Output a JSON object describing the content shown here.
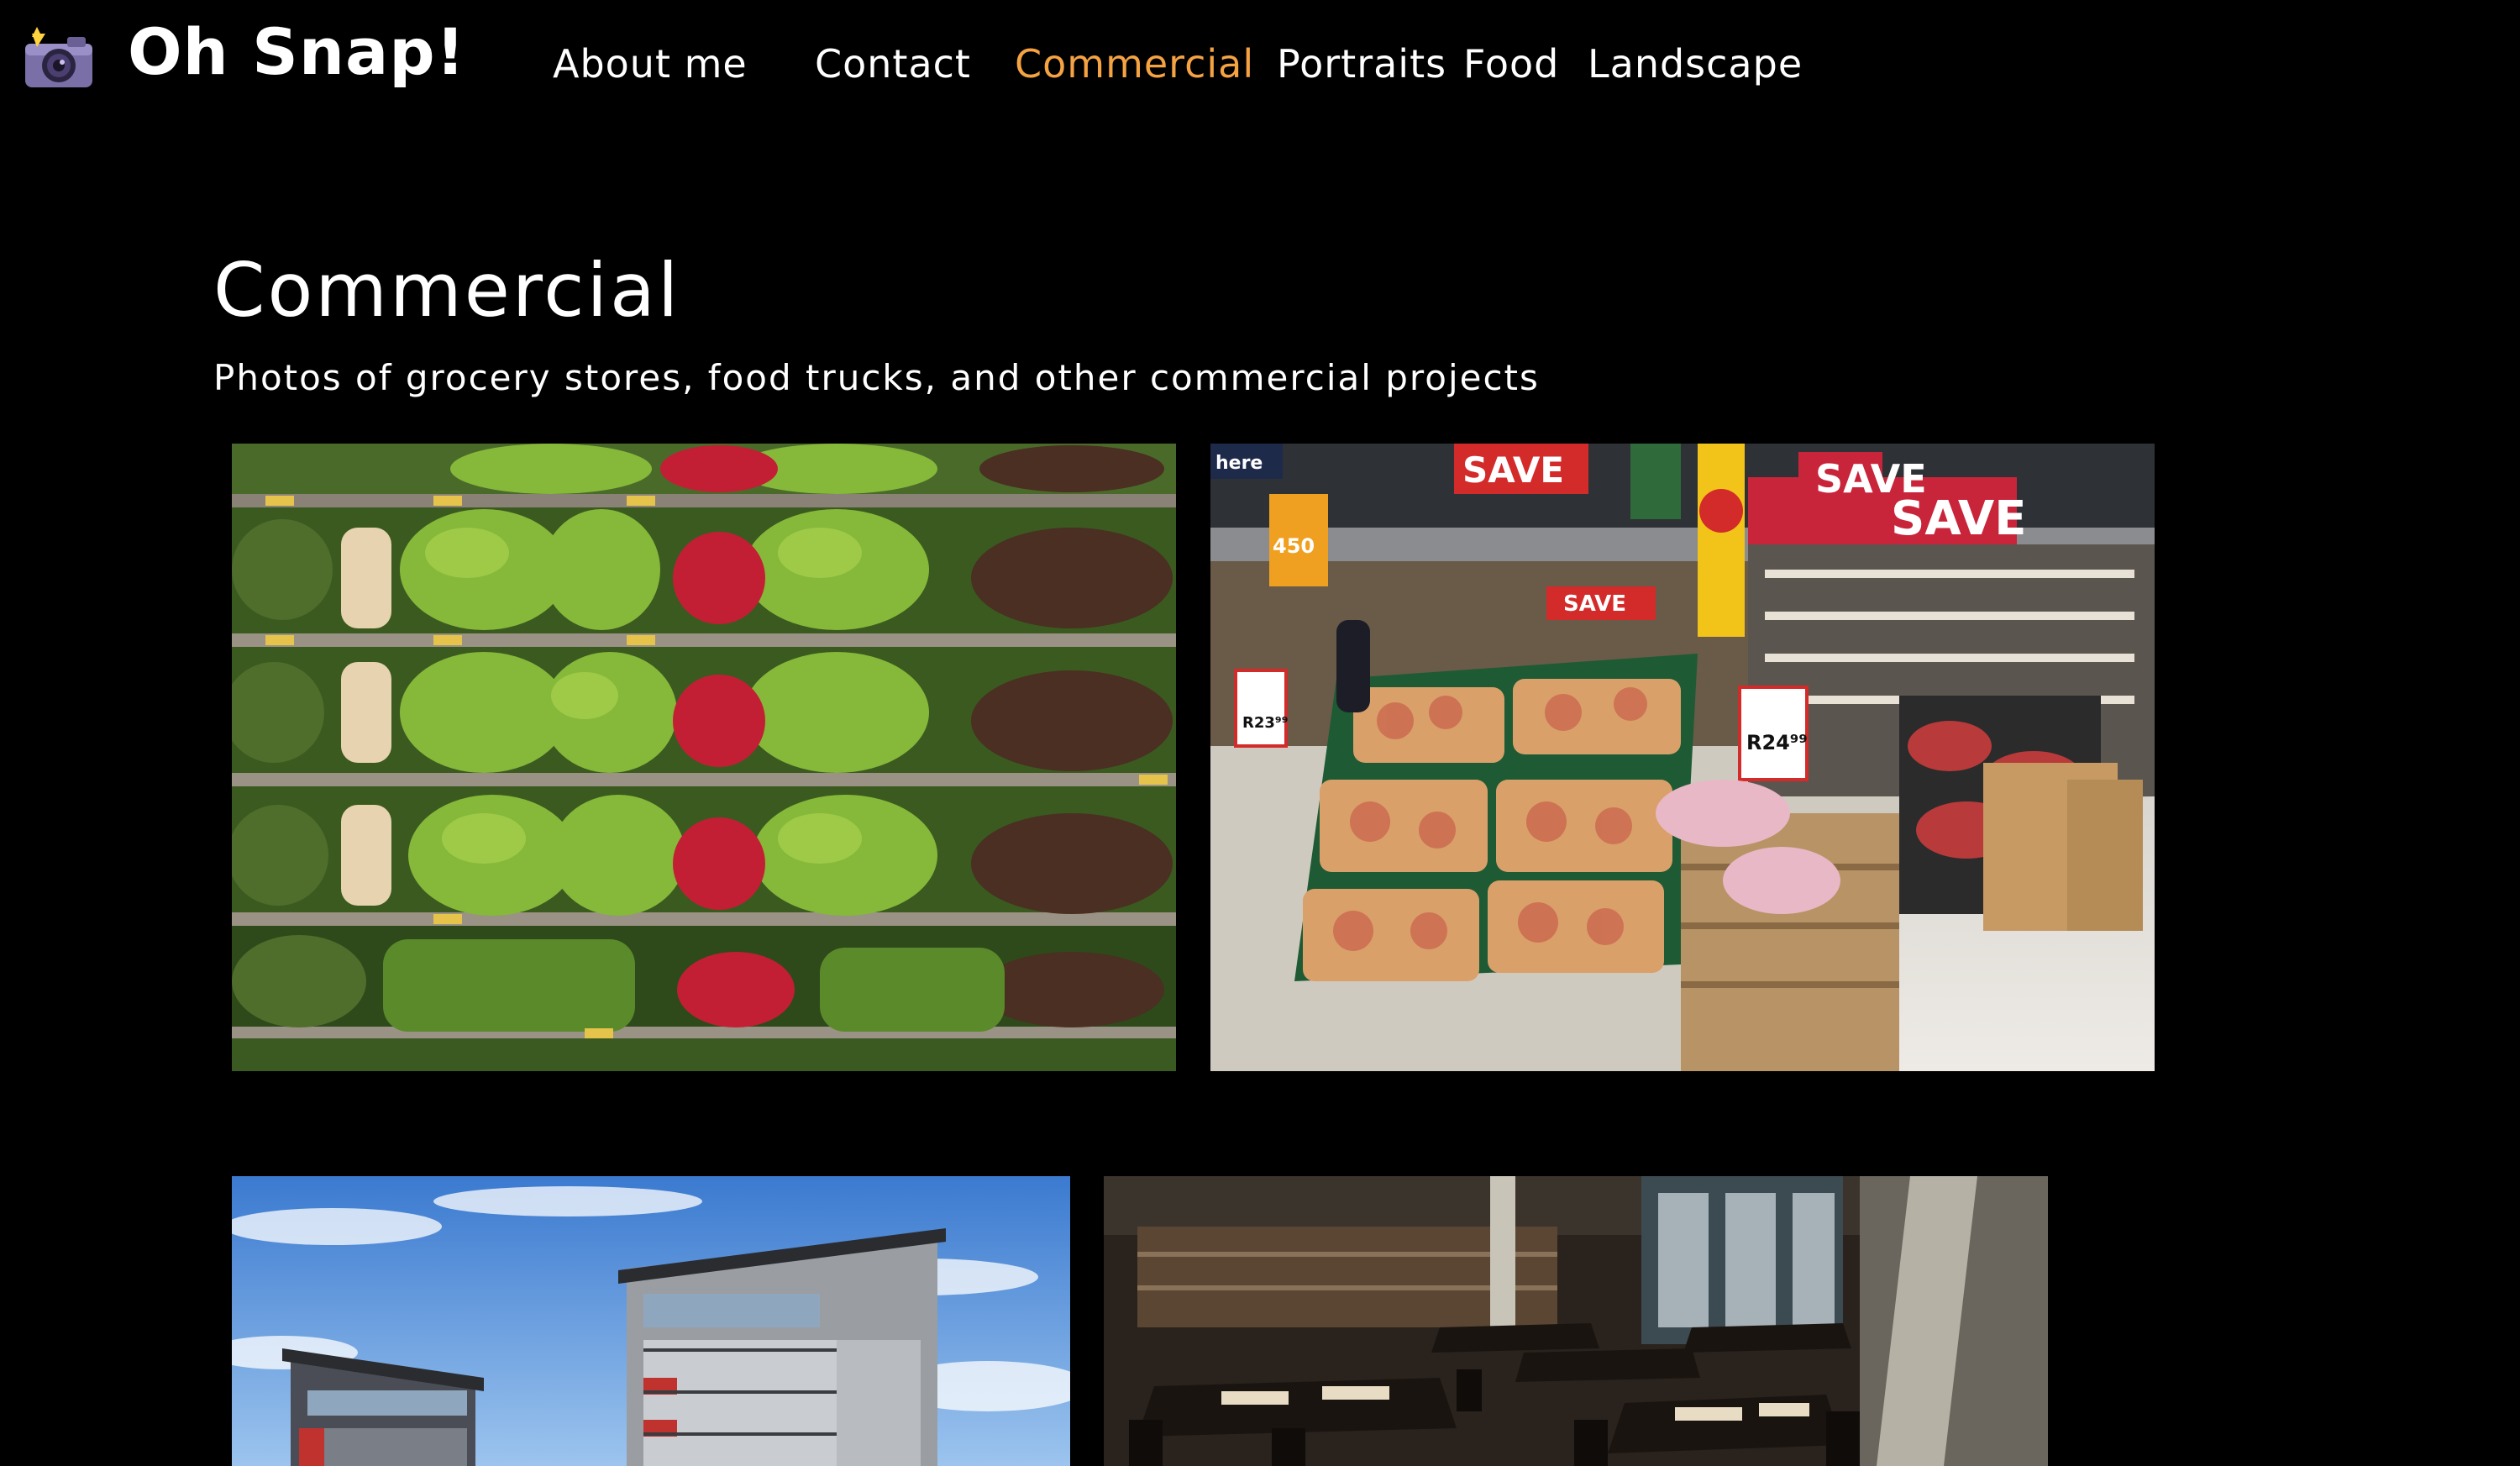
{
  "header": {
    "brand": "Oh Snap!",
    "logo_icon": "camera-with-flash-icon"
  },
  "nav": {
    "items": [
      {
        "label": "About me",
        "active": false
      },
      {
        "label": "Contact",
        "active": false
      },
      {
        "label": "Commercial",
        "active": true
      },
      {
        "label": "Portraits",
        "active": false
      },
      {
        "label": "Food",
        "active": false
      },
      {
        "label": "Landscape",
        "active": false
      }
    ],
    "active_color": "#f5a242"
  },
  "main": {
    "title": "Commercial",
    "subtitle": "Photos of grocery stores, food trucks, and other commercial projects",
    "photos": [
      {
        "subject": "produce-shelves"
      },
      {
        "subject": "supermarket-fruit-aisle",
        "signs": [
          "SAVE",
          "SAVE",
          "SAVE",
          "R23⁹⁹",
          "R24⁹⁹",
          "450",
          "here"
        ]
      },
      {
        "subject": "modern-apartment-building"
      },
      {
        "subject": "restaurant-interior"
      }
    ]
  }
}
